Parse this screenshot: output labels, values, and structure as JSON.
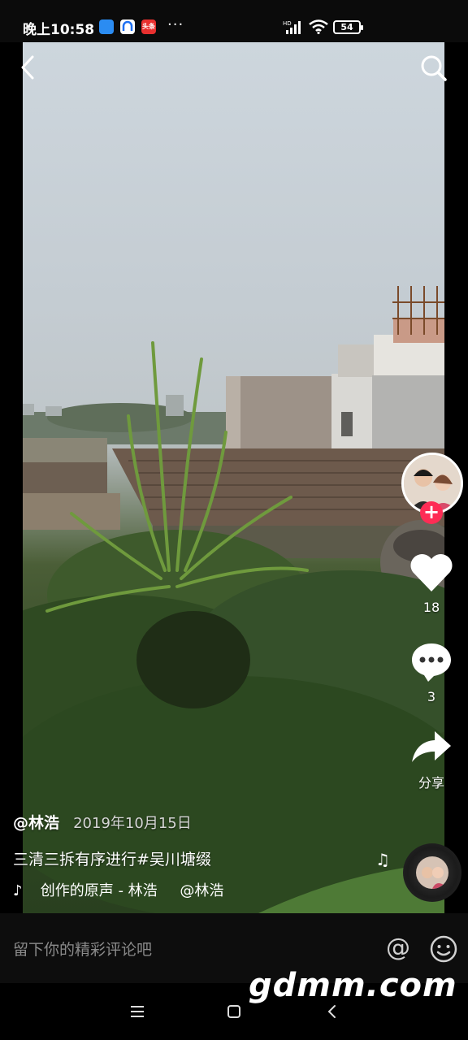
{
  "status_bar": {
    "time": "晚上10:58",
    "apps": [
      {
        "icon": "app-blue-icon",
        "color": "#2b8cf2"
      },
      {
        "icon": "app-browser-icon",
        "color": "#1e6ff1"
      },
      {
        "icon": "toutiao-icon",
        "color": "#e8302f",
        "label": "头条"
      }
    ],
    "more": "···",
    "hd_label": "HD",
    "battery": "54"
  },
  "header": {
    "back_icon": "chevron-left-icon",
    "search_icon": "search-icon"
  },
  "actions": {
    "likes": "18",
    "comments": "3",
    "share_label": "分享"
  },
  "caption": {
    "author": "@林浩",
    "date": "2019年10月15日",
    "description": "三清三拆有序进行#吴川塘缀",
    "music": "创作的原声 - 林浩",
    "music_mention": "@林浩"
  },
  "comment_bar": {
    "placeholder": "留下你的精彩评论吧",
    "at_icon": "@"
  },
  "watermark": "gdmm.com",
  "colors": {
    "accent": "#fe2c55",
    "background": "#000000"
  }
}
